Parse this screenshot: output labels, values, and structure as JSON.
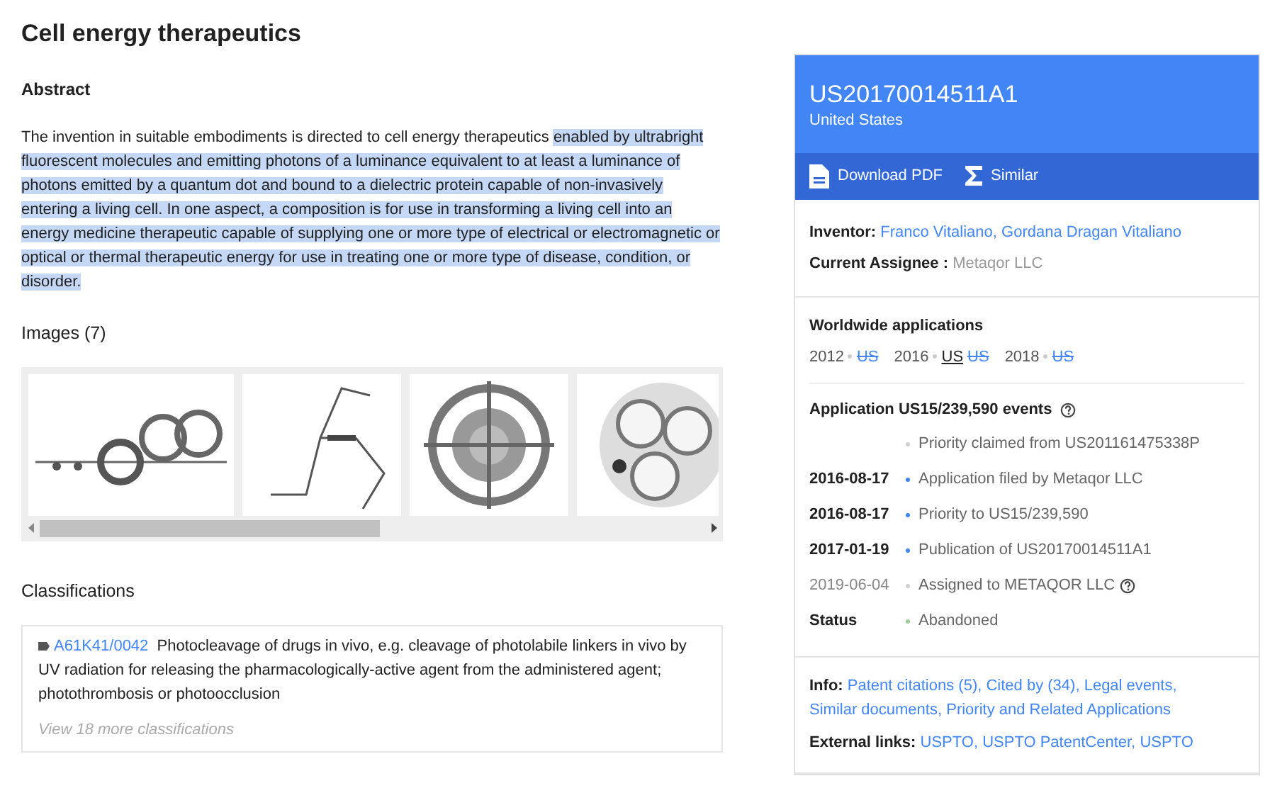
{
  "title": "Cell energy therapeutics",
  "abstract": {
    "heading": "Abstract",
    "parts": [
      {
        "text": "The invention in suitable embodiments is directed to cell energy therapeutics ",
        "selected": false
      },
      {
        "text": "enabled by ultrabright fluorescent molecules and emitting photons of a luminance equivalent to at least a luminance of photons emitted by a quantum dot and bound to a dielectric protein capable of non-invasively entering a living cell. In one aspect, a composition is for use in transforming a living cell into an energy medicine therapeutic capable of supplying one or more type of electrical or electromagnetic or optical or thermal therapeutic energy for use in treating one or more type of disease, condition, or disorder.",
        "selected": true
      }
    ]
  },
  "images": {
    "heading": "Images (7)"
  },
  "classifications": {
    "heading": "Classifications",
    "code": "A61K41/0042",
    "description": "Photocleavage of drugs in vivo, e.g. cleavage of photolabile linkers in vivo by UV radiation for releasing the pharmacologically-active agent from the administered agent; photothrombosis or photoocclusion",
    "more": "View 18 more classifications"
  },
  "patent": {
    "number": "US20170014511A1",
    "country": "United States",
    "actions": [
      {
        "kind": "pdf",
        "label": "Download PDF"
      },
      {
        "kind": "similar",
        "label": "Similar"
      }
    ],
    "inventor": {
      "label": "Inventor:",
      "value": "Franco Vitaliano, Gordana Dragan Vitaliano"
    },
    "assignee": {
      "label": "Current Assignee :",
      "value": "Metaqor LLC"
    },
    "worldwide": {
      "heading": "Worldwide applications",
      "years": [
        {
          "year": "2012",
          "countries": [
            {
              "code": "US",
              "current": false
            }
          ]
        },
        {
          "year": "2016",
          "countries": [
            {
              "code": "US",
              "current": true
            },
            {
              "code": "US",
              "current": false
            }
          ]
        },
        {
          "year": "2018",
          "countries": [
            {
              "code": "US",
              "current": false
            }
          ]
        }
      ]
    },
    "events": {
      "heading": "Application US15/239,590 events",
      "items": [
        {
          "text": "Priority claimed from US201161475338P",
          "color": "#d0d0d0",
          "help": false
        },
        {
          "date": "2016-08-17",
          "text": "Application filed by Metaqor LLC",
          "emphasized": true,
          "color": "#4285f4",
          "help": false
        },
        {
          "date": "2016-08-17",
          "text": "Priority to US15/239,590",
          "emphasized": true,
          "color": "#4285f4",
          "help": false
        },
        {
          "date": "2017-01-19",
          "text": "Publication of US20170014511A1",
          "emphasized": true,
          "color": "#4285f4",
          "help": false
        },
        {
          "date": "2019-06-04",
          "text": "Assigned to METAQOR LLC",
          "emphasized": false,
          "color": "#d0d0d0",
          "help": true
        },
        {
          "date": "Status",
          "text": "Abandoned",
          "emphasized": true,
          "color": "#9ccc9c",
          "help": false
        }
      ]
    },
    "info": {
      "label": "Info:",
      "links": [
        "Patent citations (5),",
        "Cited by (34),",
        "Legal events,",
        "Similar documents,",
        "Priority and Related Applications"
      ]
    },
    "external": {
      "label": "External links:",
      "links": [
        "USPTO,",
        "USPTO PatentCenter,",
        "USPTO"
      ]
    }
  }
}
